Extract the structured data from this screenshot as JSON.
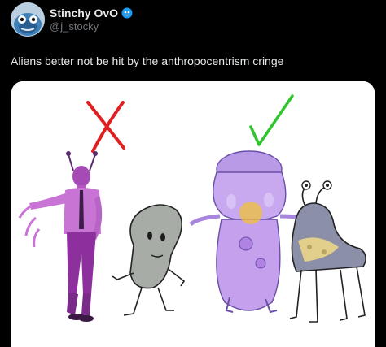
{
  "author": {
    "name": "Stinchy OvO",
    "handle": "@j_stocky",
    "avatar_icon": "blue-creature-avatar",
    "verified_icon": "blue-bubble-badge-icon"
  },
  "tweet": {
    "text": "Aliens better not be hit by the anthropocentrism cringe"
  },
  "media": {
    "wrong_mark_icon": "red-x-icon",
    "right_mark_icon": "green-check-icon",
    "wrong_color": "#e02020",
    "right_color": "#2ec52e",
    "figures": [
      "purple-suit-humanoid",
      "grey-blob-creature",
      "purple-tentacle-alien",
      "four-legged-eyestalk-alien"
    ]
  },
  "colors": {
    "background": "#000000",
    "text_primary": "#e7e9ea",
    "text_secondary": "#71767b"
  }
}
